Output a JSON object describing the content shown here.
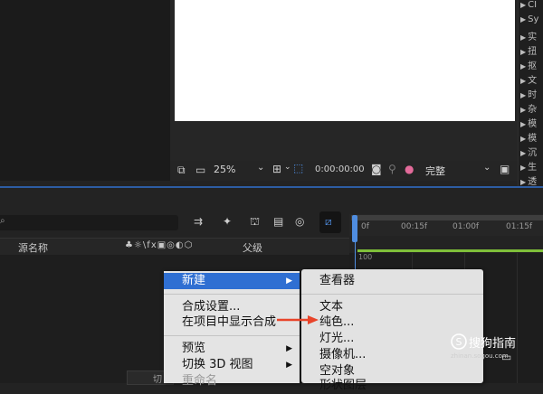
{
  "composition": {
    "zoom": "25%",
    "timecode": "0:00:00:00",
    "quality": "完整"
  },
  "effects_panel": {
    "items": [
      "CI",
      "Sy",
      "实",
      "扭",
      "抠",
      "文",
      "时",
      "杂",
      "模",
      "模",
      "沉",
      "生",
      "透"
    ]
  },
  "timeline": {
    "search_icon": "search-icon",
    "columns": {
      "source_name": "源名称",
      "parent": "父级"
    },
    "ruler_ticks": [
      "0f",
      "00:15f",
      "01:00f",
      "01:15f"
    ],
    "track_label": "100",
    "bottom_button": "切"
  },
  "menu_main": {
    "new": "新建",
    "comp_settings": "合成设置...",
    "reveal_in_project": "在项目中显示合成",
    "preview": "预览",
    "toggle_3d_view": "切换 3D 视图",
    "rename": "重命名"
  },
  "menu_sub": {
    "viewer": "查看器",
    "text": "文本",
    "solid": "纯色...",
    "light": "灯光...",
    "camera": "摄像机...",
    "null": "空对象",
    "shape": "形状图层"
  },
  "watermark": {
    "brand": "搜狗指南",
    "url": "zhinan.sogou.com"
  },
  "colors": {
    "accent_blue": "#2f6fd2",
    "arrow_red": "#e8442a",
    "work_area_green": "#7fbf3a"
  }
}
